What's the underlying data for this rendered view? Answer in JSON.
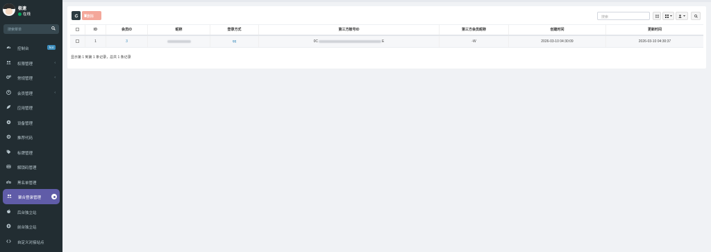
{
  "user": {
    "name": "极速",
    "status": "在线"
  },
  "sidebar": {
    "search_placeholder": "搜索菜单",
    "items": [
      {
        "label": "控制台",
        "icon": "dashboard-icon",
        "badge": "hot"
      },
      {
        "label": "权限管理",
        "icon": "users-icon",
        "caret": "‹"
      },
      {
        "label": "常规管理",
        "icon": "cogs-icon",
        "caret": "‹"
      },
      {
        "label": "会员管理",
        "icon": "user-circle-icon",
        "caret": "‹"
      },
      {
        "label": "应用管理",
        "icon": "leaf-icon"
      },
      {
        "label": "设备管理",
        "icon": "circle-icon"
      },
      {
        "label": "推荐代码",
        "icon": "target-icon"
      },
      {
        "label": "标牌管理",
        "icon": "tag-icon"
      },
      {
        "label": "解锁码管理",
        "icon": "layers-icon"
      },
      {
        "label": "黑名单管理",
        "icon": "bicycle-icon"
      },
      {
        "label": "聚合登录管理",
        "icon": "users-icon",
        "active": true
      },
      {
        "label": "后台独立站",
        "icon": "apple-icon"
      },
      {
        "label": "前台独立站",
        "icon": "plus-circle-icon"
      },
      {
        "label": "自定义对接站点",
        "icon": "code-icon"
      }
    ]
  },
  "toolbar": {
    "refresh_icon": "refresh-icon",
    "delete_label": "删除",
    "search_placeholder": "搜索"
  },
  "table": {
    "columns": [
      "",
      "ID",
      "会员ID",
      "昵称",
      "登录方式",
      "第三方账号ID",
      "第三方会员昵称",
      "创建时间",
      "更新时间"
    ],
    "rows": [
      {
        "id": "1",
        "member_id": "3",
        "nickname": "",
        "login_type": "qq",
        "third_party_id": "0C",
        "third_party_id_end": "E",
        "third_party_nickname": "-W",
        "created_at": "2026-03-10 04:30:09",
        "updated_at": "2026-03-10 04:30:37"
      }
    ]
  },
  "pagination": {
    "summary": "显示第 1 到第 1 条记录，总共 1 条记录"
  },
  "colors": {
    "sidebar_bg": "#222d32",
    "active": "#605ca8",
    "link": "#3c8dbc",
    "delete": "#f4a79a"
  }
}
